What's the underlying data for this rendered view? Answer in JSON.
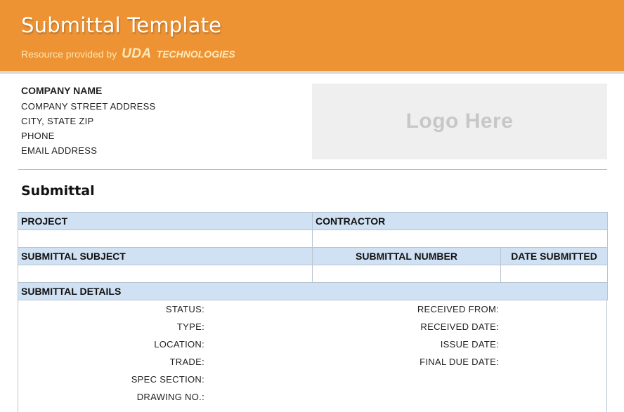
{
  "banner": {
    "title": "Submittal Template",
    "subtitle": "Resource provided by",
    "brand_main": "UDA",
    "brand_secondary": "TECHNOLOGIES",
    "accent_color": "#ee9333"
  },
  "company": {
    "name": "COMPANY NAME",
    "street": "COMPANY STREET ADDRESS",
    "city": "CITY, STATE ZIP",
    "phone": "PHONE",
    "email": "EMAIL ADDRESS"
  },
  "logo": {
    "placeholder": "Logo Here"
  },
  "section_title": "Submittal",
  "table": {
    "project_label": "PROJECT",
    "contractor_label": "CONTRACTOR",
    "subject_label": "SUBMITTAL SUBJECT",
    "number_label": "SUBMITTAL NUMBER",
    "date_label": "DATE SUBMITTED",
    "details_label": "SUBMITTAL DETAILS",
    "header_color": "#cfe1f3"
  },
  "details": {
    "left": [
      "STATUS:",
      "TYPE:",
      "LOCATION:",
      "TRADE:",
      "SPEC SECTION:",
      "DRAWING NO.:"
    ],
    "right": [
      "RECEIVED FROM:",
      "RECEIVED DATE:",
      "ISSUE DATE:",
      "FINAL DUE DATE:"
    ]
  }
}
